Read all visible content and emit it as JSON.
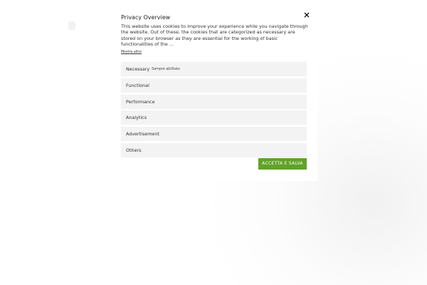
{
  "modal": {
    "title": "Privacy Overview",
    "description": "This website uses cookies to improve your experience while you navigate through the website. Out of these, the cookies that are categorized as necessary are stored on your browser as they are essential for the working of basic functionalities of the ...",
    "show_more": "Mostra altro",
    "close_icon": "close-icon",
    "categories": [
      {
        "label": "Necessary",
        "status": "Sempre abilitato"
      },
      {
        "label": "Functional",
        "status": ""
      },
      {
        "label": "Performance",
        "status": ""
      },
      {
        "label": "Analytics",
        "status": ""
      },
      {
        "label": "Advertisement",
        "status": ""
      },
      {
        "label": "Others",
        "status": ""
      }
    ],
    "accept_button": "ACCETTA E SALVA"
  },
  "colors": {
    "accent": "#61a229",
    "category_background": "#f3f3f3",
    "text": "#333333"
  }
}
